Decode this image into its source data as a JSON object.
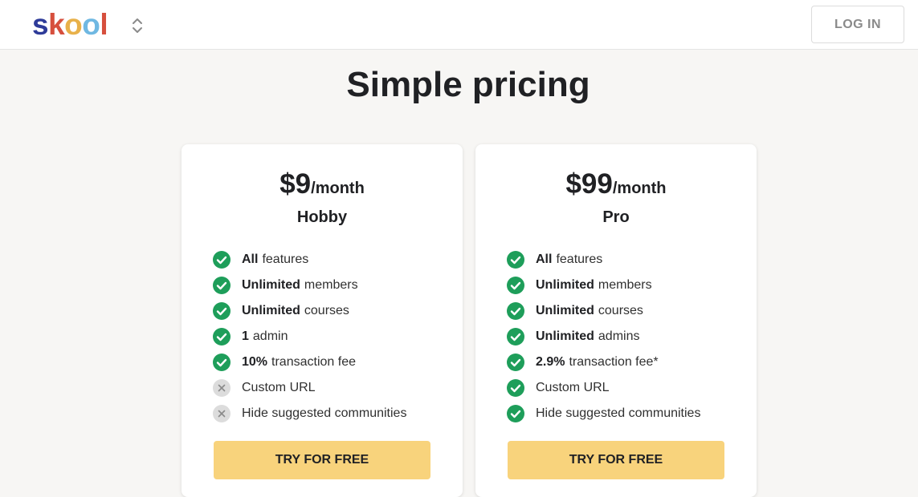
{
  "header": {
    "logo_text": [
      "s",
      "k",
      "o",
      "o",
      "l"
    ],
    "switcher_icon": "chevron-up-down-icon",
    "login_label": "LOG IN"
  },
  "main": {
    "title": "Simple pricing"
  },
  "plans": [
    {
      "price": "$9",
      "period": "/month",
      "name": "Hobby",
      "cta_label": "TRY FOR FREE",
      "features": [
        {
          "included": true,
          "bold": "All",
          "text": "features"
        },
        {
          "included": true,
          "bold": "Unlimited",
          "text": "members"
        },
        {
          "included": true,
          "bold": "Unlimited",
          "text": "courses"
        },
        {
          "included": true,
          "bold": "1",
          "text": "admin"
        },
        {
          "included": true,
          "bold": "10%",
          "text": "transaction fee"
        },
        {
          "included": false,
          "bold": "",
          "text": "Custom URL"
        },
        {
          "included": false,
          "bold": "",
          "text": "Hide suggested communities"
        }
      ]
    },
    {
      "price": "$99",
      "period": "/month",
      "name": "Pro",
      "cta_label": "TRY FOR FREE",
      "features": [
        {
          "included": true,
          "bold": "All",
          "text": "features"
        },
        {
          "included": true,
          "bold": "Unlimited",
          "text": "members"
        },
        {
          "included": true,
          "bold": "Unlimited",
          "text": "courses"
        },
        {
          "included": true,
          "bold": "Unlimited",
          "text": "admins"
        },
        {
          "included": true,
          "bold": "2.9%",
          "text": "transaction fee*"
        },
        {
          "included": true,
          "bold": "",
          "text": "Custom URL"
        },
        {
          "included": true,
          "bold": "",
          "text": "Hide suggested communities"
        }
      ]
    }
  ],
  "colors": {
    "check_green": "#1e9e5a",
    "cross_gray": "#dcdcdc",
    "cta_yellow": "#f8d37c"
  }
}
